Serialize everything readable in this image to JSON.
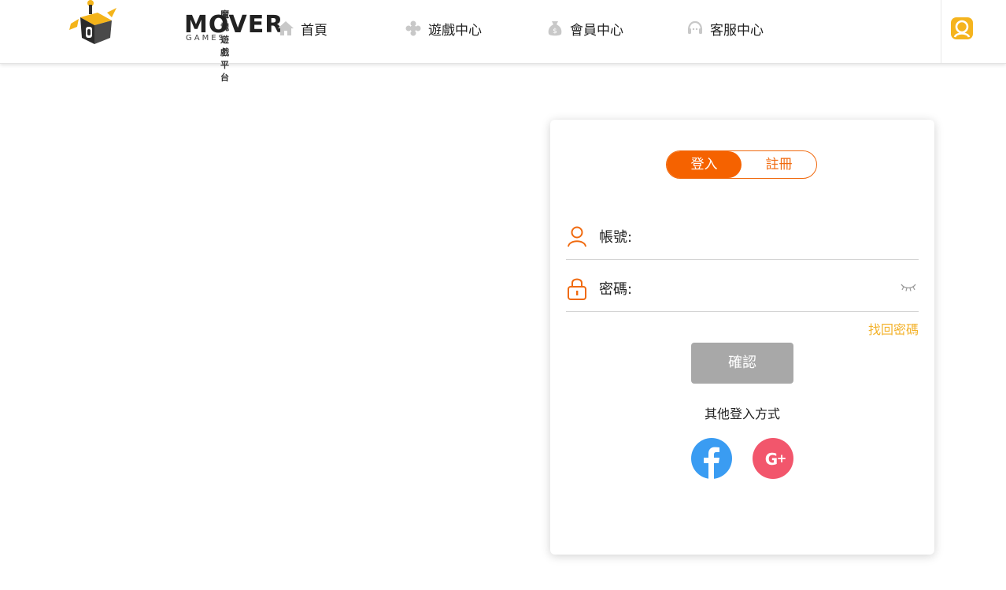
{
  "brand": {
    "subtitle": "魔塊遊戲平台",
    "wordmark": "MOVER",
    "games": "GAMES"
  },
  "nav": [
    {
      "label": "首頁",
      "icon": "home-icon"
    },
    {
      "label": "遊戲中心",
      "icon": "gamepad-icon"
    },
    {
      "label": "會員中心",
      "icon": "money-bag-icon"
    },
    {
      "label": "客服中心",
      "icon": "headset-icon"
    }
  ],
  "header": {
    "user_icon": "user-avatar-icon"
  },
  "login": {
    "tabs": {
      "login": "登入",
      "register": "註冊"
    },
    "account_label": "帳號:",
    "password_label": "密碼:",
    "forgot": "找回密碼",
    "confirm": "確認",
    "other_methods": "其他登入方式"
  },
  "colors": {
    "accent": "#f56200",
    "gold": "#f3b22b",
    "facebook": "#3a9cf2",
    "google": "#f2566c",
    "button_disabled": "#a8a8a8"
  }
}
